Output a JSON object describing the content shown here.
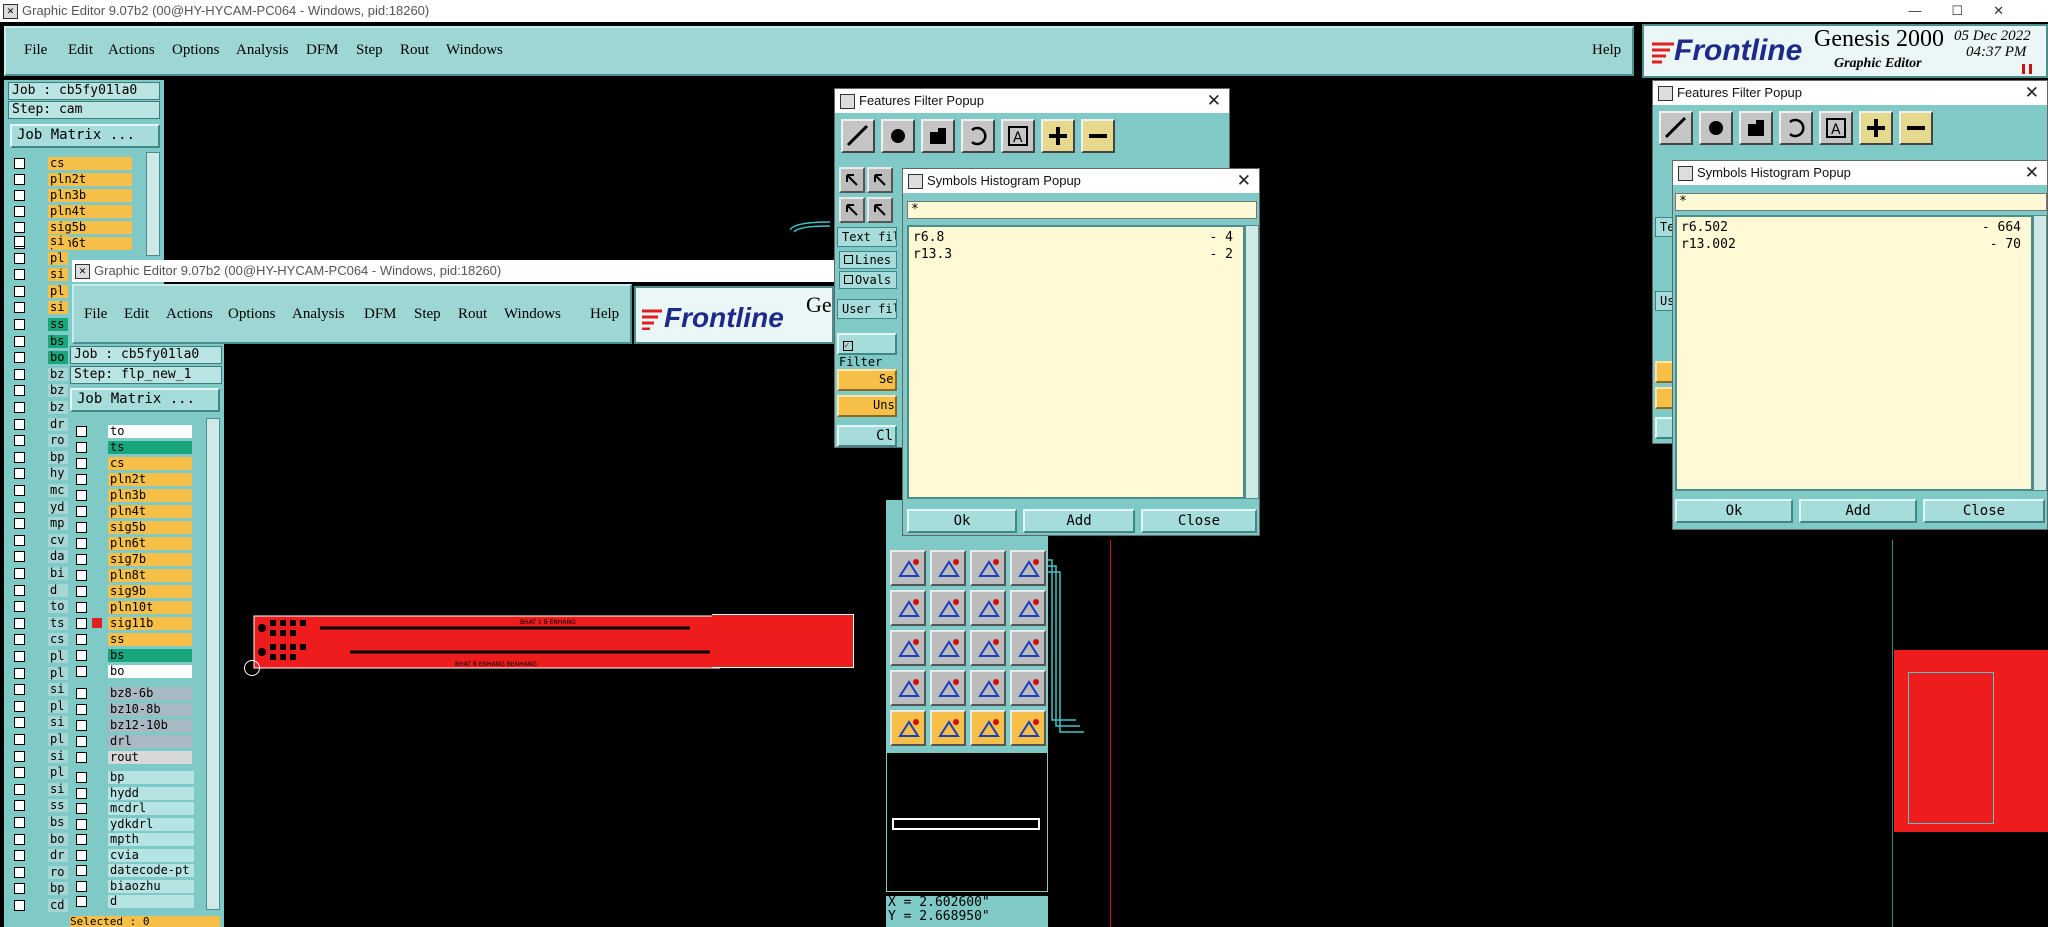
{
  "main_window": {
    "title": "Graphic Editor 9.07b2 (00@HY-HYCAM-PC064 - Windows, pid:18260)",
    "menu": [
      "File",
      "Edit",
      "Actions",
      "Options",
      "Analysis",
      "DFM",
      "Step",
      "Rout",
      "Windows"
    ],
    "help": "Help",
    "brand": "Frontline",
    "product": "Genesis 2000",
    "subtitle": "Graphic Editor",
    "date": "05 Dec 2022",
    "time": "04:37 PM",
    "job": "Job : cb5fy01la0",
    "step": "Step: cam",
    "job_matrix": "Job Matrix ...",
    "layers_top": [
      "cs",
      "pln2t",
      "pln3b",
      "pln4t",
      "sig5b",
      "pln6t"
    ],
    "left_col_labels": [
      "si",
      "pl",
      "si",
      "pl",
      "si",
      "ss",
      "bs",
      "bo",
      "bz",
      "bz",
      "bz",
      "dr",
      "ro",
      "bp",
      "hy",
      "mc",
      "yd",
      "mp",
      "cv",
      "da",
      "bi",
      "d",
      "to",
      "ts",
      "cs",
      "pl",
      "pl",
      "si",
      "pl",
      "si",
      "pl",
      "si",
      "pl",
      "si",
      "ss",
      "bs",
      "bo",
      "dr",
      "ro",
      "bp",
      "cd"
    ]
  },
  "second_window": {
    "title": "Graphic Editor 9.07b2 (00@HY-HYCAM-PC064 - Windows, pid:18260)",
    "menu": [
      "File",
      "Edit",
      "Actions",
      "Options",
      "Analysis",
      "DFM",
      "Step",
      "Rout",
      "Windows"
    ],
    "help": "Help",
    "brand": "Frontline",
    "brand_tail": "Ge",
    "job": "Job : cb5fy01la0",
    "step": "Step: flp_new_1",
    "job_matrix": "Job Matrix ...",
    "layers": [
      {
        "name": "to",
        "color": "#ffffff"
      },
      {
        "name": "ts",
        "color": "#18a67d"
      },
      {
        "name": "cs",
        "color": "#f6c048"
      },
      {
        "name": "pln2t",
        "color": "#f6c048"
      },
      {
        "name": "pln3b",
        "color": "#f6c048"
      },
      {
        "name": "pln4t",
        "color": "#f6c048"
      },
      {
        "name": "sig5b",
        "color": "#f6c048"
      },
      {
        "name": "pln6t",
        "color": "#f6c048"
      },
      {
        "name": "sig7b",
        "color": "#f6c048"
      },
      {
        "name": "pln8t",
        "color": "#f6c048"
      },
      {
        "name": "sig9b",
        "color": "#f6c048"
      },
      {
        "name": "pln10t",
        "color": "#f6c048"
      },
      {
        "name": "sig11b",
        "color": "#f6c048"
      },
      {
        "name": "ss",
        "color": "#f6c048"
      },
      {
        "name": "bs",
        "color": "#18a67d"
      },
      {
        "name": "bo",
        "color": "#ffffff"
      }
    ],
    "drill_layers": [
      "bz8-6b",
      "bz10-8b",
      "bz12-10b",
      "drl",
      "rout"
    ],
    "misc_layers": [
      "bp",
      "hydd",
      "mcdrl",
      "ydkdrl",
      "mpth",
      "cvia",
      "datecode-pt",
      "biaozhu",
      "d"
    ],
    "selected": "Selected : 0",
    "coord_x": "X = 2.602600\"",
    "coord_y": "Y = 2.668950\""
  },
  "features_filter_left": {
    "title": "Features Filter Popup",
    "text_filter": "Text filt",
    "lines": "Lines",
    "ovals": "Ovals",
    "user_filter": "User filt",
    "filter": "Filter",
    "select": "Sele",
    "unselect": "Unse",
    "clear": "Cl"
  },
  "symbols_hist_left": {
    "title": "Symbols Histogram Popup",
    "filter_value": "*",
    "rows": [
      {
        "sym": "r6.8",
        "count": "- 4"
      },
      {
        "sym": "r13.3",
        "count": "- 2"
      }
    ],
    "ok": "Ok",
    "add": "Add",
    "close": "Close"
  },
  "features_filter_right": {
    "title": "Features Filter Popup",
    "text_filter": "Tex",
    "user_filter": "Us"
  },
  "symbols_hist_right": {
    "title": "Symbols Histogram Popup",
    "filter_value": "*",
    "rows": [
      {
        "sym": "r6.502",
        "count": "- 664"
      },
      {
        "sym": "r13.002",
        "count": "- 70"
      }
    ],
    "ok": "Ok",
    "add": "Add",
    "close": "Close"
  },
  "pcb_text": {
    "top": "BHAT 1 B ENHANG",
    "bottom": "BHAT B ENHANG BENHANG"
  },
  "colors": {
    "menu_teal": "#9ed6d4",
    "panel_teal": "#7fc9c6",
    "layer_orange": "#f6c048",
    "pcb_red": "#ee1c1c",
    "popup_yellow": "#fff9d6"
  }
}
